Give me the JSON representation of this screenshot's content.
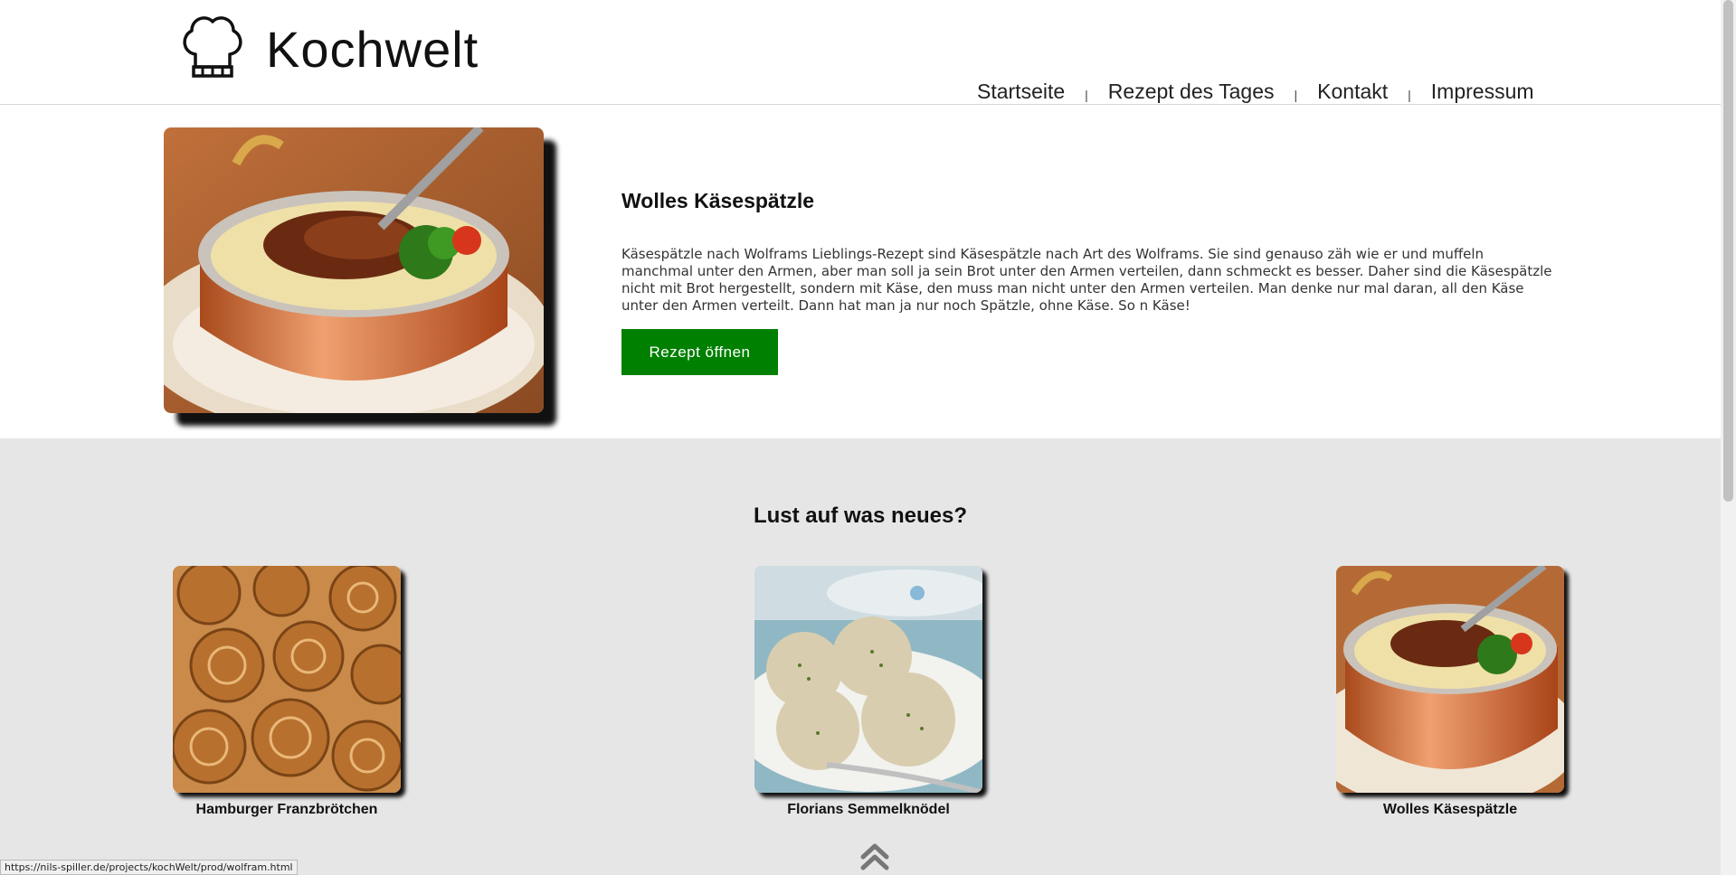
{
  "header": {
    "logo_text": "Kochwelt",
    "logo_icon": "chef-hat-icon",
    "nav": [
      {
        "label": "Startseite"
      },
      {
        "label": "Rezept des Tages"
      },
      {
        "label": "Kontakt"
      },
      {
        "label": "Impressum"
      }
    ],
    "separator": "|"
  },
  "featured": {
    "title": "Wolles Käsespätzle",
    "description": "Käsespätzle nach Wolframs Lieblings-Rezept sind Käsespätzle nach Art des Wolframs. Sie sind genauso zäh wie er und muffeln manchmal unter den Armen, aber man soll ja sein Brot unter den Armen verteilen, dann schmeckt es besser. Daher sind die Käsespätzle nicht mit Brot hergestellt, sondern mit Käse, den muss man nicht unter den Armen verteilen. Man denke nur mal daran, all den Käse unter den Armen verteilt. Dann hat man ja nur noch Spätzle, ohne Käse. So n Käse!",
    "button_label": "Rezept öffnen",
    "button_color": "#008000"
  },
  "suggestions": {
    "title": "Lust auf was neues?",
    "cards": [
      {
        "label": "Hamburger Franzbrötchen"
      },
      {
        "label": "Florians Semmelknödel"
      },
      {
        "label": "Wolles Käsespätzle"
      }
    ],
    "background": "#e6e6e6"
  },
  "status_url": "https://nils-spiller.de/projects/kochWelt/prod/wolfram.html"
}
